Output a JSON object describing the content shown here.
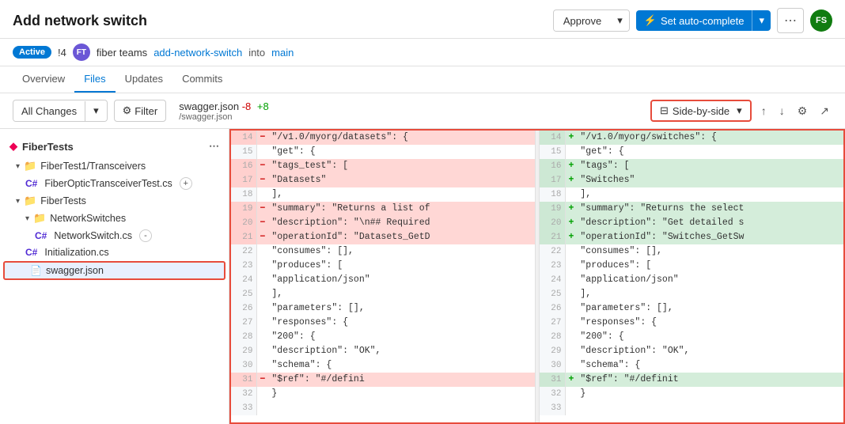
{
  "header": {
    "title": "Add network switch",
    "approve_label": "Approve",
    "autocomplete_label": "Set auto-complete",
    "more_dots": "⋯",
    "avatar_initials": "FS"
  },
  "sub_header": {
    "badge": "Active",
    "pr_number": "!4",
    "avatar_initials": "FT",
    "user": "fiber teams",
    "branch_from": "add-network-switch",
    "into": "into",
    "branch_to": "main"
  },
  "tabs": [
    {
      "label": "Overview",
      "active": false
    },
    {
      "label": "Files",
      "active": true
    },
    {
      "label": "Updates",
      "active": false
    },
    {
      "label": "Commits",
      "active": false
    }
  ],
  "toolbar": {
    "all_changes_label": "All Changes",
    "filter_label": "Filter",
    "file_name": "swagger.json",
    "del_count": "-8",
    "add_count": "+8",
    "file_path": "/swagger.json",
    "side_by_side_label": "Side-by-side"
  },
  "sidebar": {
    "header": "FiberTests",
    "items": [
      {
        "type": "folder",
        "label": "FiberTest1/Transceivers",
        "level": 1,
        "expanded": true
      },
      {
        "type": "file",
        "label": "FiberOpticTransceiverTest.cs",
        "badge": "C#",
        "level": 2,
        "has_plus": true
      },
      {
        "type": "folder",
        "label": "FiberTests",
        "level": 1,
        "expanded": true
      },
      {
        "type": "folder",
        "label": "NetworkSwitches",
        "level": 2,
        "expanded": true
      },
      {
        "type": "file",
        "label": "NetworkSwitch.cs",
        "badge": "C#",
        "level": 3,
        "has_minus": true
      },
      {
        "type": "file",
        "label": "Initialization.cs",
        "badge": "C#",
        "level": 2
      },
      {
        "type": "file",
        "label": "swagger.json",
        "level": 2,
        "selected": true,
        "json": true
      }
    ]
  },
  "diff": {
    "left": {
      "lines": [
        {
          "num": 14,
          "type": "del",
          "code": "    \"/v1.0/myorg/datasets\": {"
        },
        {
          "num": 15,
          "type": "normal",
          "code": "      \"get\": {"
        },
        {
          "num": 16,
          "type": "del",
          "code": "        \"tags_test\": ["
        },
        {
          "num": 17,
          "type": "del",
          "code": "          \"Datasets\""
        },
        {
          "num": 18,
          "type": "normal",
          "code": "        ],"
        },
        {
          "num": 19,
          "type": "del",
          "code": "        \"summary\": \"Returns a list of"
        },
        {
          "num": 20,
          "type": "del",
          "code": "        \"description\": \"\\n## Required"
        },
        {
          "num": 21,
          "type": "del",
          "code": "        \"operationId\": \"Datasets_GetD"
        },
        {
          "num": 22,
          "type": "normal",
          "code": "        \"consumes\": [],"
        },
        {
          "num": 23,
          "type": "normal",
          "code": "        \"produces\": ["
        },
        {
          "num": 24,
          "type": "normal",
          "code": "          \"application/json\""
        },
        {
          "num": 25,
          "type": "normal",
          "code": "        ],"
        },
        {
          "num": 26,
          "type": "normal",
          "code": "        \"parameters\": [],"
        },
        {
          "num": 27,
          "type": "normal",
          "code": "        \"responses\": {"
        },
        {
          "num": 28,
          "type": "normal",
          "code": "          \"200\": {"
        },
        {
          "num": 29,
          "type": "normal",
          "code": "            \"description\": \"OK\","
        },
        {
          "num": 30,
          "type": "normal",
          "code": "            \"schema\": {"
        },
        {
          "num": 31,
          "type": "del",
          "code": "              \"$ref\": \"#/defini"
        },
        {
          "num": 32,
          "type": "normal",
          "code": "            }"
        },
        {
          "num": 33,
          "type": "normal",
          "code": ""
        }
      ]
    },
    "right": {
      "lines": [
        {
          "num": 14,
          "type": "add",
          "code": "    \"/v1.0/myorg/switches\": {"
        },
        {
          "num": 15,
          "type": "normal",
          "code": "      \"get\": {"
        },
        {
          "num": 16,
          "type": "add",
          "code": "        \"tags\": ["
        },
        {
          "num": 17,
          "type": "add",
          "code": "          \"Switches\""
        },
        {
          "num": 18,
          "type": "normal",
          "code": "        ],"
        },
        {
          "num": 19,
          "type": "add",
          "code": "        \"summary\": \"Returns the select"
        },
        {
          "num": 20,
          "type": "add",
          "code": "        \"description\": \"Get detailed s"
        },
        {
          "num": 21,
          "type": "add",
          "code": "        \"operationId\": \"Switches_GetSw"
        },
        {
          "num": 22,
          "type": "normal",
          "code": "        \"consumes\": [],"
        },
        {
          "num": 23,
          "type": "normal",
          "code": "        \"produces\": ["
        },
        {
          "num": 24,
          "type": "normal",
          "code": "          \"application/json\""
        },
        {
          "num": 25,
          "type": "normal",
          "code": "        ],"
        },
        {
          "num": 26,
          "type": "normal",
          "code": "        \"parameters\": [],"
        },
        {
          "num": 27,
          "type": "normal",
          "code": "        \"responses\": {"
        },
        {
          "num": 28,
          "type": "normal",
          "code": "          \"200\": {"
        },
        {
          "num": 29,
          "type": "normal",
          "code": "            \"description\": \"OK\","
        },
        {
          "num": 30,
          "type": "normal",
          "code": "            \"schema\": {"
        },
        {
          "num": 31,
          "type": "add",
          "code": "              \"$ref\": \"#/definit"
        },
        {
          "num": 32,
          "type": "normal",
          "code": "            }"
        },
        {
          "num": 33,
          "type": "normal",
          "code": ""
        }
      ]
    }
  }
}
